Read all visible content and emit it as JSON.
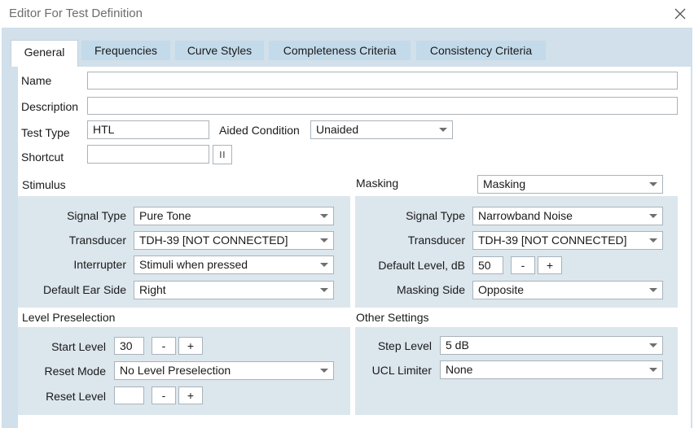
{
  "window": {
    "title": "Editor For Test Definition"
  },
  "tabs": [
    {
      "label": "General"
    },
    {
      "label": "Frequencies"
    },
    {
      "label": "Curve Styles"
    },
    {
      "label": "Completeness Criteria"
    },
    {
      "label": "Consistency Criteria"
    }
  ],
  "general": {
    "name_label": "Name",
    "name_value": "",
    "description_label": "Description",
    "description_value": "",
    "test_type_label": "Test Type",
    "test_type_value": "HTL",
    "aided_label": "Aided Condition",
    "aided_value": "Unaided",
    "shortcut_label": "Shortcut",
    "shortcut_value": ""
  },
  "stimulus": {
    "heading": "Stimulus",
    "signal_type_label": "Signal Type",
    "signal_type_value": "Pure Tone",
    "transducer_label": "Transducer",
    "transducer_value": "TDH-39 [NOT CONNECTED]",
    "interrupter_label": "Interrupter",
    "interrupter_value": "Stimuli when pressed",
    "ear_side_label": "Default Ear Side",
    "ear_side_value": "Right"
  },
  "masking": {
    "heading": "Masking",
    "mode_value": "Masking",
    "signal_type_label": "Signal Type",
    "signal_type_value": "Narrowband Noise",
    "transducer_label": "Transducer",
    "transducer_value": "TDH-39 [NOT CONNECTED]",
    "default_level_label": "Default Level, dB",
    "default_level_value": "50",
    "side_label": "Masking Side",
    "side_value": "Opposite"
  },
  "level_preselection": {
    "heading": "Level Preselection",
    "start_level_label": "Start Level",
    "start_level_value": "30",
    "reset_mode_label": "Reset Mode",
    "reset_mode_value": "No Level Preselection",
    "reset_level_label": "Reset Level",
    "reset_level_value": ""
  },
  "other_settings": {
    "heading": "Other Settings",
    "step_level_label": "Step Level",
    "step_level_value": "5 dB",
    "ucl_label": "UCL Limiter",
    "ucl_value": "None"
  },
  "buttons": {
    "minus": "-",
    "plus": "+"
  }
}
